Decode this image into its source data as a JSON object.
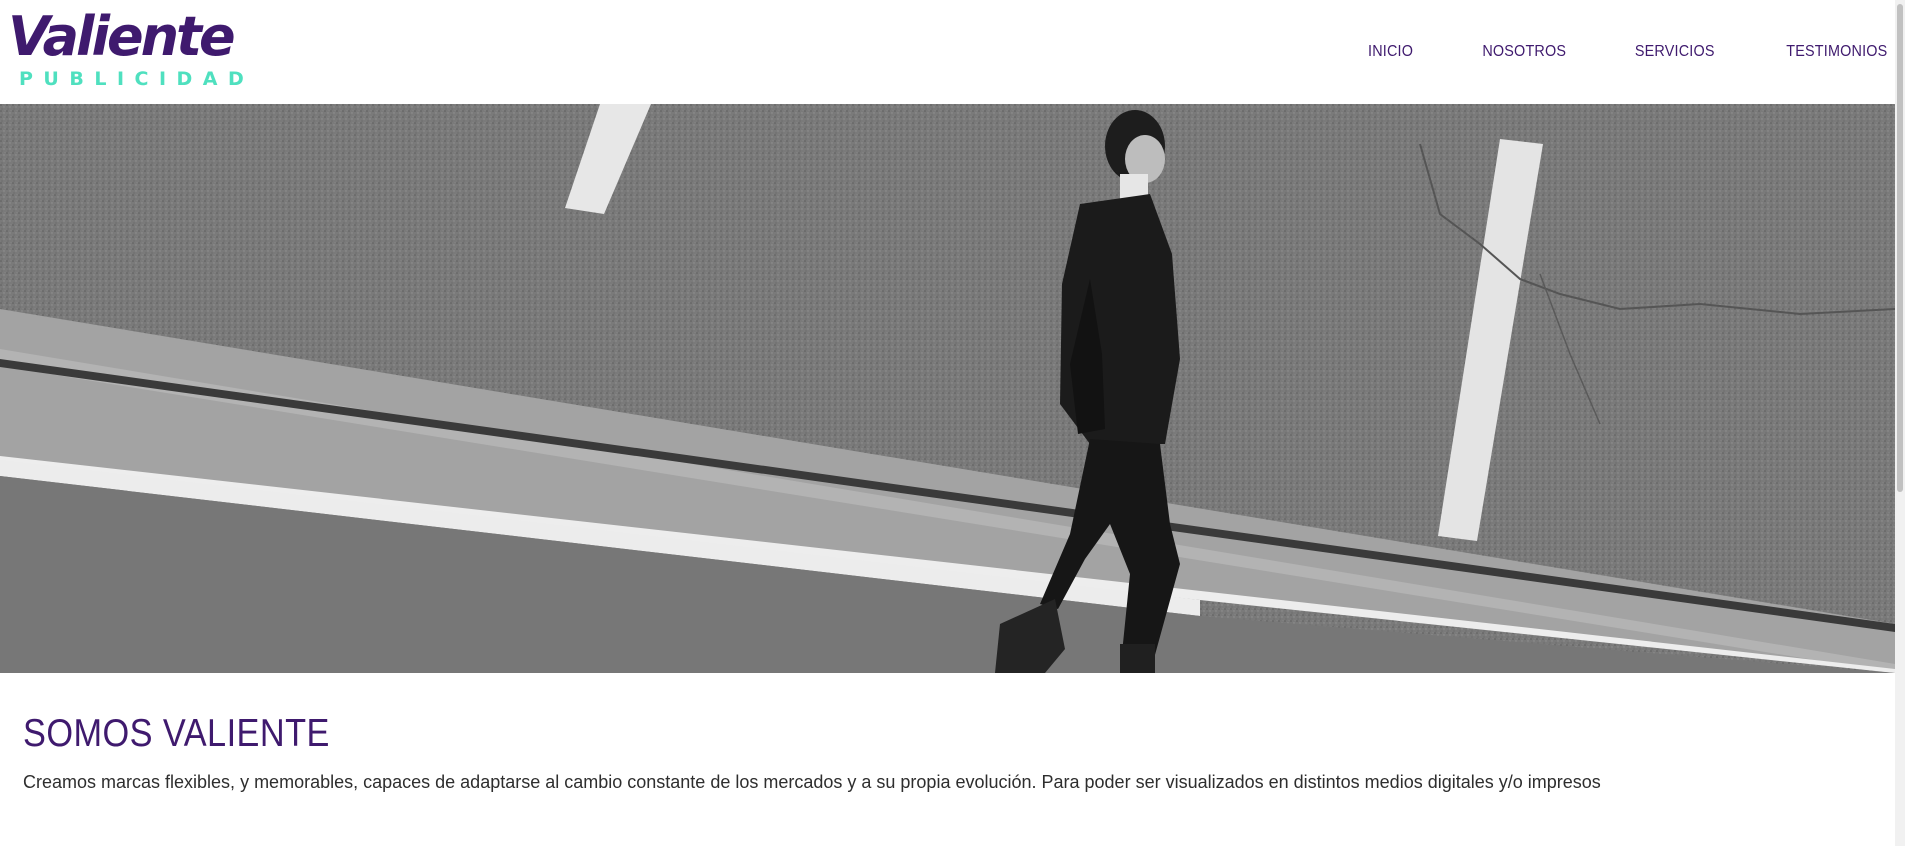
{
  "brand": {
    "name": "Valiente",
    "tagline": "PUBLICIDAD",
    "primary_color": "#3f1a6e",
    "accent_color": "#4fe0bf"
  },
  "nav": {
    "items": [
      {
        "label": "INICIO"
      },
      {
        "label": "NOSOTROS"
      },
      {
        "label": "SERVICIOS"
      },
      {
        "label": "TESTIMONIOS"
      }
    ]
  },
  "hero": {
    "image_icon": "photo-icon"
  },
  "about": {
    "title": "SOMOS VALIENTE",
    "text": "Creamos marcas flexibles, y memorables, capaces de adaptarse al cambio constante de los mercados y a su propia evolución. Para poder ser visualizados en distintos medios digitales y/o impresos"
  }
}
